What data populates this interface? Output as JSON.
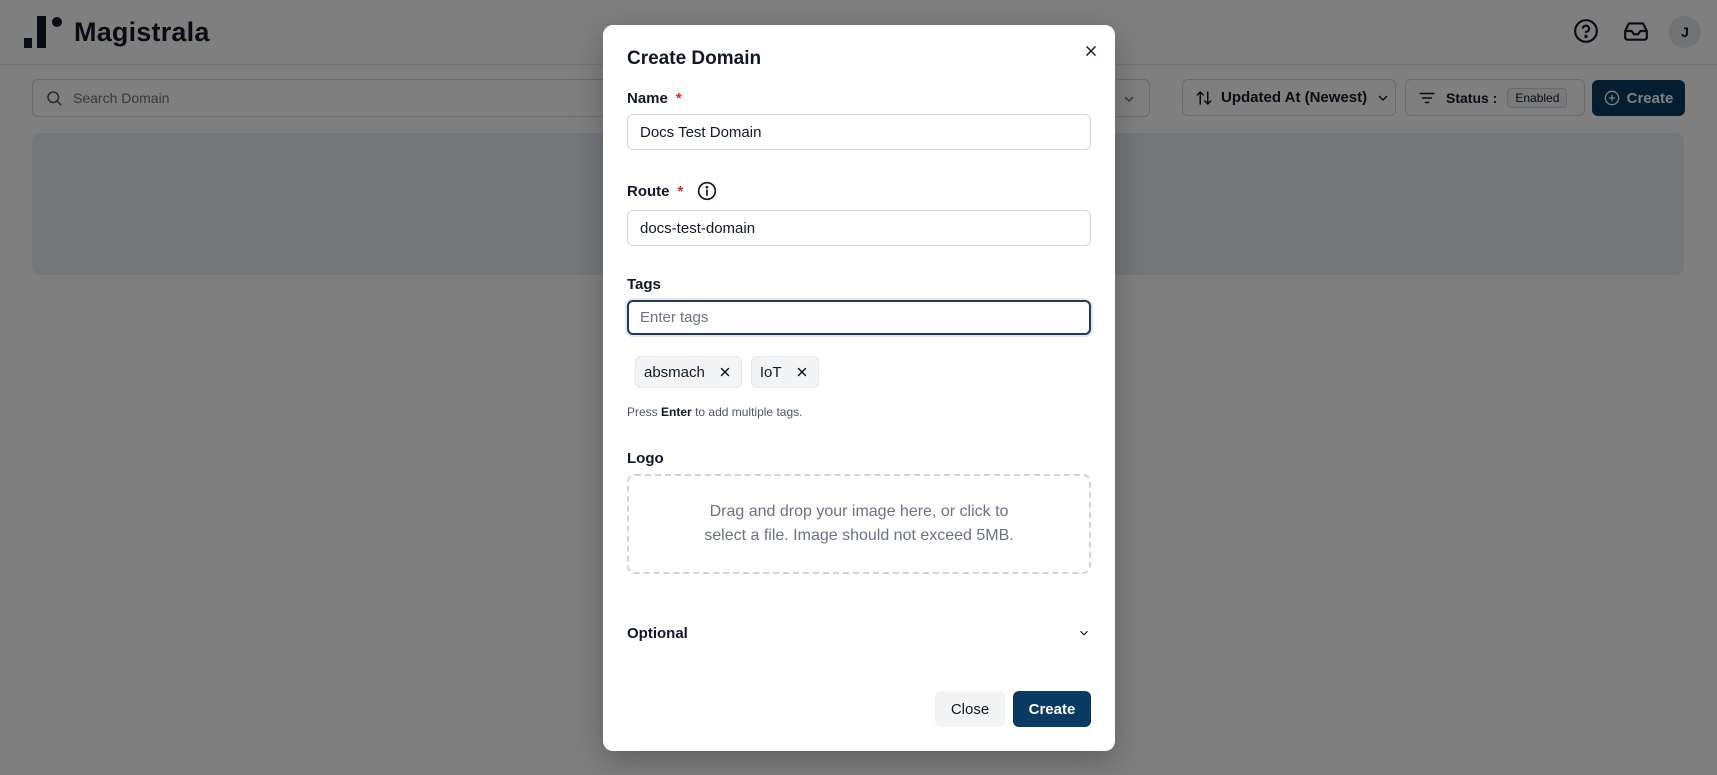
{
  "app": {
    "name": "Magistrala",
    "avatar_initial": "J"
  },
  "toolbar": {
    "search_placeholder": "Search Domain",
    "sort_label": "Updated At (Newest)",
    "status_label": "Status :",
    "status_value": "Enabled",
    "create_label": "Create"
  },
  "modal": {
    "title": "Create Domain",
    "name": {
      "label": "Name",
      "required_mark": "*",
      "value": "Docs Test Domain"
    },
    "route": {
      "label": "Route",
      "required_mark": "*",
      "value": "docs-test-domain"
    },
    "tags": {
      "label": "Tags",
      "placeholder": "Enter tags",
      "items": [
        "absmach",
        "IoT"
      ],
      "hint_prefix": "Press",
      "hint_key": "Enter",
      "hint_suffix": "to add multiple tags."
    },
    "logo": {
      "label": "Logo",
      "dropzone_text": "Drag and drop your image here, or click to select a file. Image should not exceed 5MB."
    },
    "optional_label": "Optional",
    "close_label": "Close",
    "create_label": "Create"
  },
  "colors": {
    "primary": "#0b3a63",
    "required": "#dc2626",
    "overlay": "rgba(0,0,0,0.5)"
  }
}
